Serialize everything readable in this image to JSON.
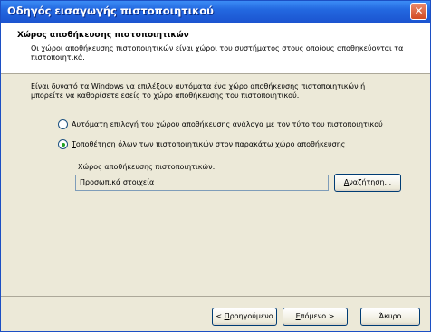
{
  "window": {
    "title": "Οδηγός εισαγωγής πιστοποιητικού"
  },
  "header": {
    "title": "Χώρος αποθήκευσης πιστοποιητικών",
    "description": "Οι χώροι αποθήκευσης πιστοποιητικών είναι χώροι του συστήματος στους οποίους αποθηκεύονται τα πιστοποιητικά."
  },
  "body": {
    "intro": "Είναι δυνατό τα Windows να επιλέξουν αυτόματα ένα χώρο αποθήκευσης πιστοποιητικών ή μπορείτε να καθορίσετε εσείς το χώρο αποθήκευσης του πιστοποιητικού.",
    "options": [
      {
        "label": "Αυτόματη επιλογή του χώρου αποθήκευσης ανάλογα με τον τύπο του πιστοποιητικού",
        "selected": false
      },
      {
        "label_mnemonic": "Τ",
        "label_rest": "οποθέτηση όλων των πιστοποιητικών στον παρακάτω χώρο αποθήκευσης",
        "selected": true
      }
    ],
    "store_label": "Χώρος αποθήκευσης πιστοποιητικών:",
    "store_value": "Προσωπικά στοιχεία",
    "browse_mnemonic": "Α",
    "browse_rest": "ναζήτηση..."
  },
  "footer": {
    "back_prefix": "< ",
    "back_mnemonic": "Π",
    "back_rest": "ροηγούμενο",
    "next_mnemonic": "Ε",
    "next_rest": "πόμενο >",
    "cancel": "Άκυρο"
  }
}
